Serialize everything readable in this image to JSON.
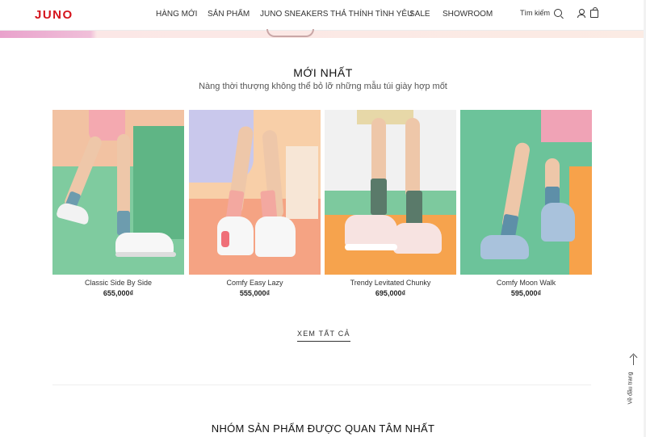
{
  "header": {
    "logo": "JUNO",
    "nav": [
      "HÀNG MỚI",
      "SẢN PHẨM",
      "JUNO SNEAKERS THẢ THÍNH TÌNH YÊU",
      "SALE",
      "SHOWROOM"
    ],
    "search_label": "Tìm kiếm"
  },
  "new_section": {
    "title": "MỚI NHẤT",
    "subtitle": "Nàng thời thượng không thể bỏ lỡ những mẫu túi giày hợp mốt",
    "view_all": "XEM TẤT CẢ"
  },
  "products": [
    {
      "name": "Classic Side By Side",
      "price": "655,000₫",
      "bg": "#79c99b"
    },
    {
      "name": "Comfy Easy Lazy",
      "price": "555,000₫",
      "bg": "#f3a07b"
    },
    {
      "name": "Trendy Levitated Chunky",
      "price": "695,000₫",
      "bg": "#f6a34d"
    },
    {
      "name": "Comfy Moon Walk",
      "price": "595,000₫",
      "bg": "#6cc39a"
    }
  ],
  "section2": {
    "title": "NHÓM SẢN PHẨM ĐƯỢC QUAN TÂM NHẤT"
  },
  "back_to_top": "Về đầu trang"
}
